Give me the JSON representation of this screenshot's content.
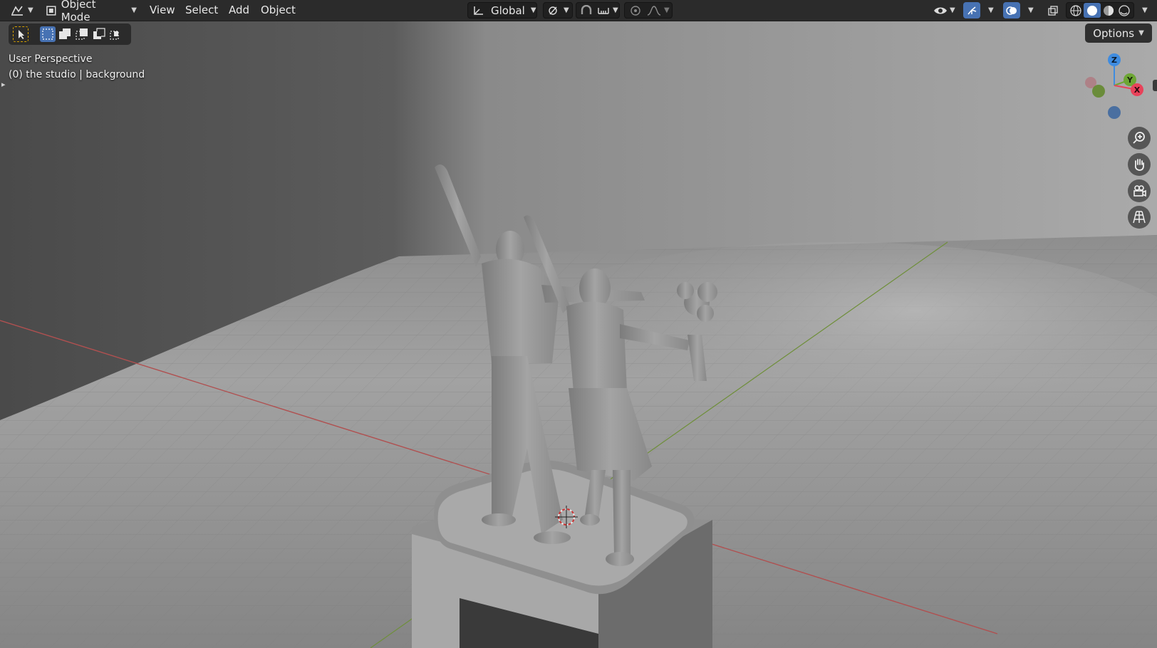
{
  "header": {
    "editor_type_icon": "editor-type-icon",
    "mode": {
      "icon": "object-mode-icon",
      "label": "Object Mode"
    },
    "menus": [
      "View",
      "Select",
      "Add",
      "Object"
    ],
    "transform_orientation": {
      "icon": "orientation-icon",
      "label": "Global"
    },
    "pivot_icon": "pivot-point-icon",
    "snap_icon": "snap-magnet-icon",
    "snap_target_icon": "snap-increment-icon",
    "proportional_icon": "proportional-edit-icon",
    "falloff_icon": "falloff-curve-icon",
    "visibility_icon": "visibility-eye-icon",
    "gizmo_icon": "gizmo-icon",
    "overlay_icon": "overlay-icon",
    "xray_icon": "xray-toggle-icon",
    "shading_modes": [
      "wireframe-shading-icon",
      "solid-shading-icon",
      "material-shading-icon",
      "rendered-shading-icon"
    ],
    "active_shading": "solid-shading-icon"
  },
  "toolbar": {
    "select_tool_icon": "select-cursor-icon",
    "selection_modes": [
      "select-new-icon",
      "select-extend-icon",
      "select-subtract-icon",
      "select-invert-icon",
      "select-intersect-icon"
    ],
    "options_label": "Options"
  },
  "viewport": {
    "view_name": "User Perspective",
    "collection_text": "(0) the studio | background"
  },
  "navigation_gizmo": {
    "axes": [
      "Z",
      "Y",
      "X"
    ],
    "colors": {
      "x": "#e8425a",
      "y": "#6da634",
      "z": "#3f8ce0"
    },
    "buttons": [
      "zoom-icon",
      "pan-hand-icon",
      "camera-view-icon",
      "ortho-grid-icon"
    ]
  },
  "colors": {
    "header_bg": "#2b2b2b",
    "accent_blue": "#4772b3",
    "x_axis_line": "#b05050",
    "y_axis_line": "#6f8f3a"
  }
}
